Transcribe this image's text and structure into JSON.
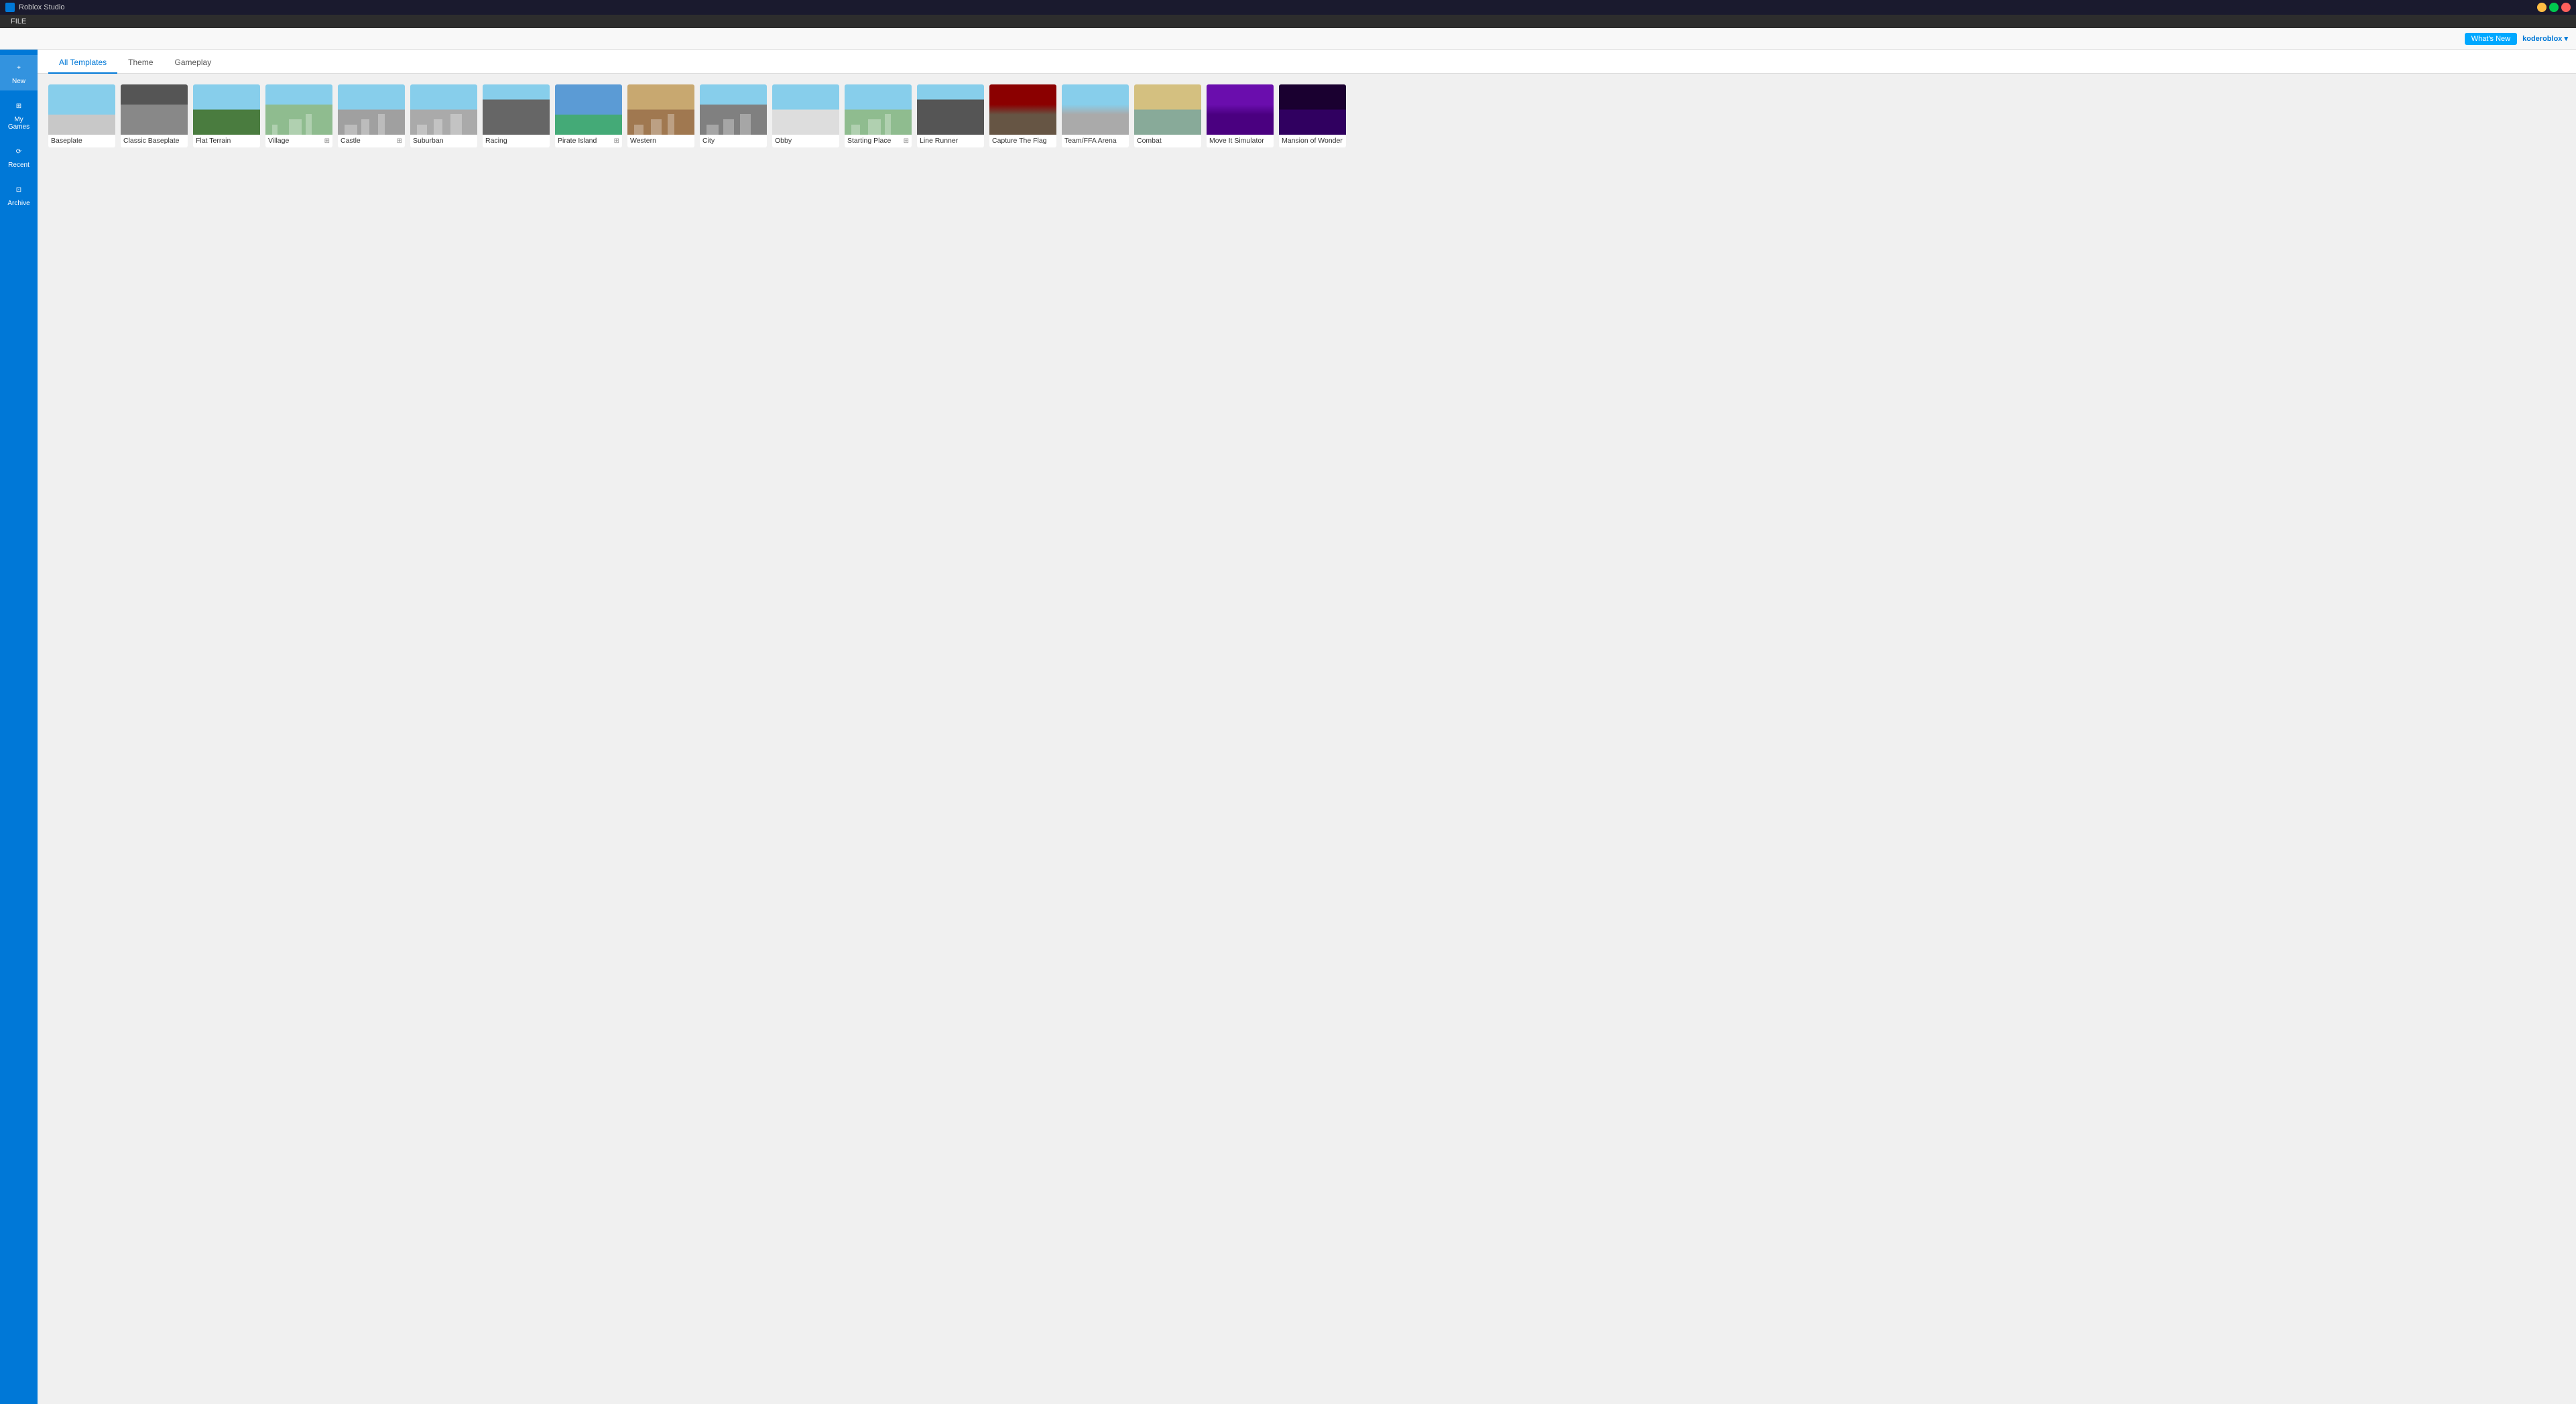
{
  "titlebar": {
    "app_name": "Roblox Studio",
    "menu_items": [
      "FILE"
    ]
  },
  "actionbar": {
    "whats_new_label": "What's New",
    "user_label": "koderoblox ▾"
  },
  "sidebar": {
    "items": [
      {
        "id": "new",
        "label": "New",
        "icon": "+"
      },
      {
        "id": "my-games",
        "label": "My Games",
        "icon": "⊞"
      },
      {
        "id": "recent",
        "label": "Recent",
        "icon": "⟳"
      },
      {
        "id": "archive",
        "label": "Archive",
        "icon": "⊡"
      }
    ]
  },
  "tabs": [
    {
      "id": "all-templates",
      "label": "All Templates",
      "active": true
    },
    {
      "id": "theme",
      "label": "Theme",
      "active": false
    },
    {
      "id": "gameplay",
      "label": "Gameplay",
      "active": false
    }
  ],
  "templates": [
    {
      "id": "baseplate",
      "name": "Baseplate",
      "has_icon": false,
      "thumb_class": "thumb-baseplate"
    },
    {
      "id": "classic-baseplate",
      "name": "Classic Baseplate",
      "has_icon": false,
      "thumb_class": "thumb-classic"
    },
    {
      "id": "flat-terrain",
      "name": "Flat Terrain",
      "has_icon": false,
      "thumb_class": "thumb-flat"
    },
    {
      "id": "village",
      "name": "Village",
      "has_icon": true,
      "thumb_class": "thumb-village"
    },
    {
      "id": "castle",
      "name": "Castle",
      "has_icon": true,
      "thumb_class": "thumb-castle"
    },
    {
      "id": "suburban",
      "name": "Suburban",
      "has_icon": false,
      "thumb_class": "thumb-suburban"
    },
    {
      "id": "racing",
      "name": "Racing",
      "has_icon": false,
      "thumb_class": "thumb-racing"
    },
    {
      "id": "pirate-island",
      "name": "Pirate Island",
      "has_icon": true,
      "thumb_class": "thumb-pirate"
    },
    {
      "id": "western",
      "name": "Western",
      "has_icon": false,
      "thumb_class": "thumb-western"
    },
    {
      "id": "city",
      "name": "City",
      "has_icon": false,
      "thumb_class": "thumb-city"
    },
    {
      "id": "obby",
      "name": "Obby",
      "has_icon": false,
      "thumb_class": "thumb-obby"
    },
    {
      "id": "starting-place",
      "name": "Starting Place",
      "has_icon": true,
      "thumb_class": "thumb-starting"
    },
    {
      "id": "line-runner",
      "name": "Line Runner",
      "has_icon": false,
      "thumb_class": "thumb-linerunner"
    },
    {
      "id": "capture-the-flag",
      "name": "Capture The Flag",
      "has_icon": false,
      "thumb_class": "thumb-capture"
    },
    {
      "id": "team-ffa-arena",
      "name": "Team/FFA Arena",
      "has_icon": false,
      "thumb_class": "thumb-team"
    },
    {
      "id": "combat",
      "name": "Combat",
      "has_icon": false,
      "thumb_class": "thumb-combat"
    },
    {
      "id": "move-it-simulator",
      "name": "Move It Simulator",
      "has_icon": false,
      "thumb_class": "thumb-moveit"
    },
    {
      "id": "mansion-of-wonder",
      "name": "Mansion of Wonder",
      "has_icon": false,
      "thumb_class": "thumb-mansion"
    }
  ]
}
